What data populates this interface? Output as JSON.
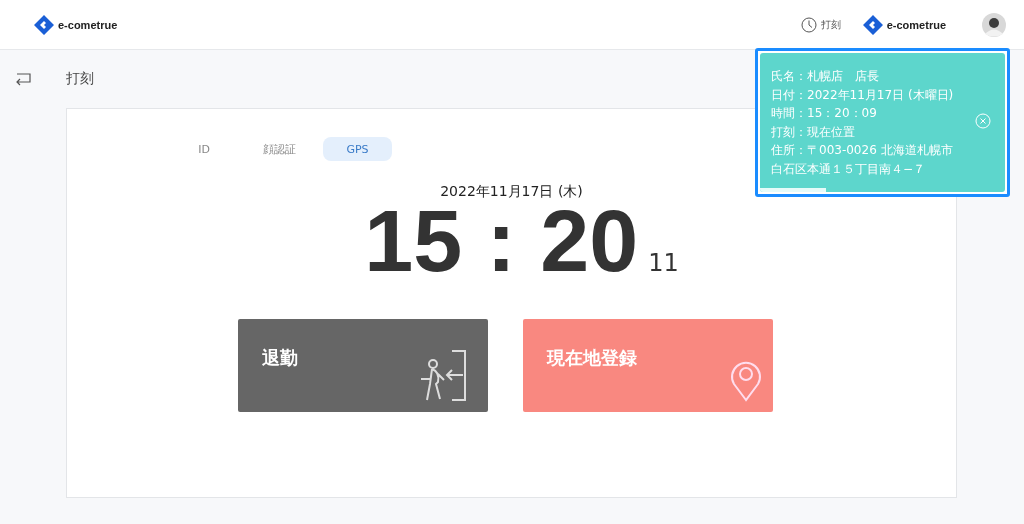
{
  "header": {
    "logo_text": "e-cometrue",
    "nav": [
      {
        "label": "打刻"
      }
    ],
    "right_logo_text": "e-cometrue"
  },
  "page": {
    "title": "打刻"
  },
  "tabs": [
    {
      "label": "ID",
      "selected": false
    },
    {
      "label": "顔認証",
      "selected": false
    },
    {
      "label": "GPS",
      "selected": true
    }
  ],
  "clock": {
    "date": "2022年11月17日 (木)",
    "time": "15 : 20",
    "seconds": "11"
  },
  "actions": [
    {
      "label": "退勤",
      "kind": "leave"
    },
    {
      "label": "現在地登録",
      "kind": "location"
    }
  ],
  "toast": {
    "lines": [
      "氏名：札幌店　店長",
      "日付：2022年11月17日 (木曜日)",
      "時間：15：20：09",
      "打刻：現在位置",
      "住所：〒003-0026 北海道札幌市",
      "白石区本通１５丁目南４−７"
    ],
    "progress": {
      "level": 0.27
    }
  }
}
